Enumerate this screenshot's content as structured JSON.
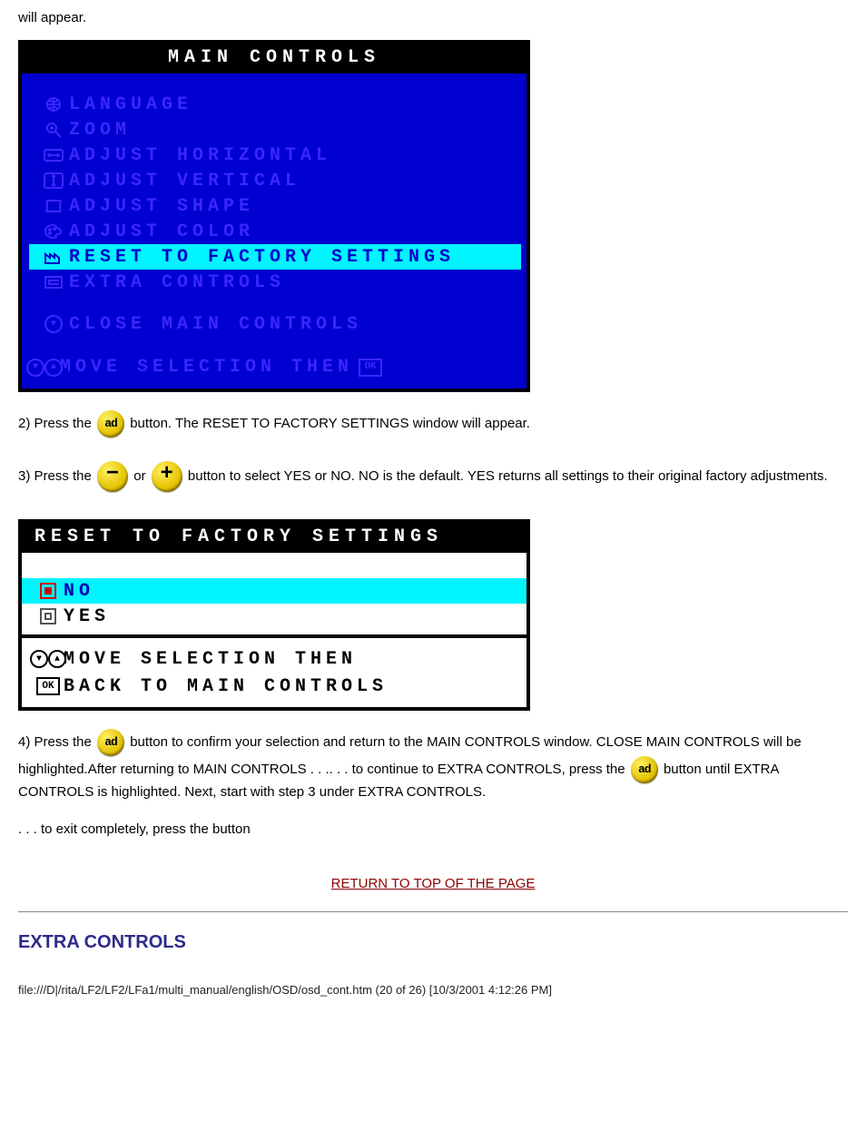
{
  "intro_text": "will appear.",
  "main_panel": {
    "title": "MAIN CONTROLS",
    "items": [
      {
        "label": "LANGUAGE",
        "icon": "globe"
      },
      {
        "label": "ZOOM",
        "icon": "magnify"
      },
      {
        "label": "ADJUST HORIZONTAL",
        "icon": "arr-h"
      },
      {
        "label": "ADJUST VERTICAL",
        "icon": "arr-v"
      },
      {
        "label": "ADJUST SHAPE",
        "icon": "shape"
      },
      {
        "label": "ADJUST COLOR",
        "icon": "palette"
      },
      {
        "label": "RESET TO FACTORY SETTINGS",
        "icon": "factory",
        "highlight": true
      },
      {
        "label": "EXTRA CONTROLS",
        "icon": "list"
      }
    ],
    "close_label": "CLOSE MAIN CONTROLS",
    "footer_label": "MOVE SELECTION THEN"
  },
  "step2": {
    "pre": "2) Press the ",
    "post": " button. The RESET TO FACTORY SETTINGS window will appear."
  },
  "step3": {
    "pre": "3) Press the ",
    "mid": " or ",
    "post": " button to select YES or NO. NO is the default. YES returns all settings to their original factory adjustments."
  },
  "reset_panel": {
    "title": "RESET TO FACTORY SETTINGS",
    "options": [
      {
        "label": "NO",
        "selected": true
      },
      {
        "label": "YES",
        "selected": false
      }
    ],
    "footer_line1": "MOVE SELECTION THEN",
    "footer_line2": "BACK TO MAIN CONTROLS"
  },
  "step4": {
    "pre": "4) Press the ",
    "mid": " button to confirm your selection and return to the MAIN CONTROLS window. CLOSE MAIN CONTROLS will be highlighted.After returning to MAIN CONTROLS . . .. . . to continue to EXTRA CONTROLS, press the ",
    "post": " button until EXTRA CONTROLS is highlighted. Next, start with step 3 under EXTRA CONTROLS."
  },
  "step5": ". . . to exit completely, press the  button",
  "return_link": "RETURN TO TOP OF THE PAGE",
  "section_heading": "EXTRA CONTROLS",
  "bottom_url": "file:///D|/rita/LF2/LF2/LFa1/multi_manual/english/OSD/osd_cont.htm (20 of 26) [10/3/2001 4:12:26 PM]"
}
